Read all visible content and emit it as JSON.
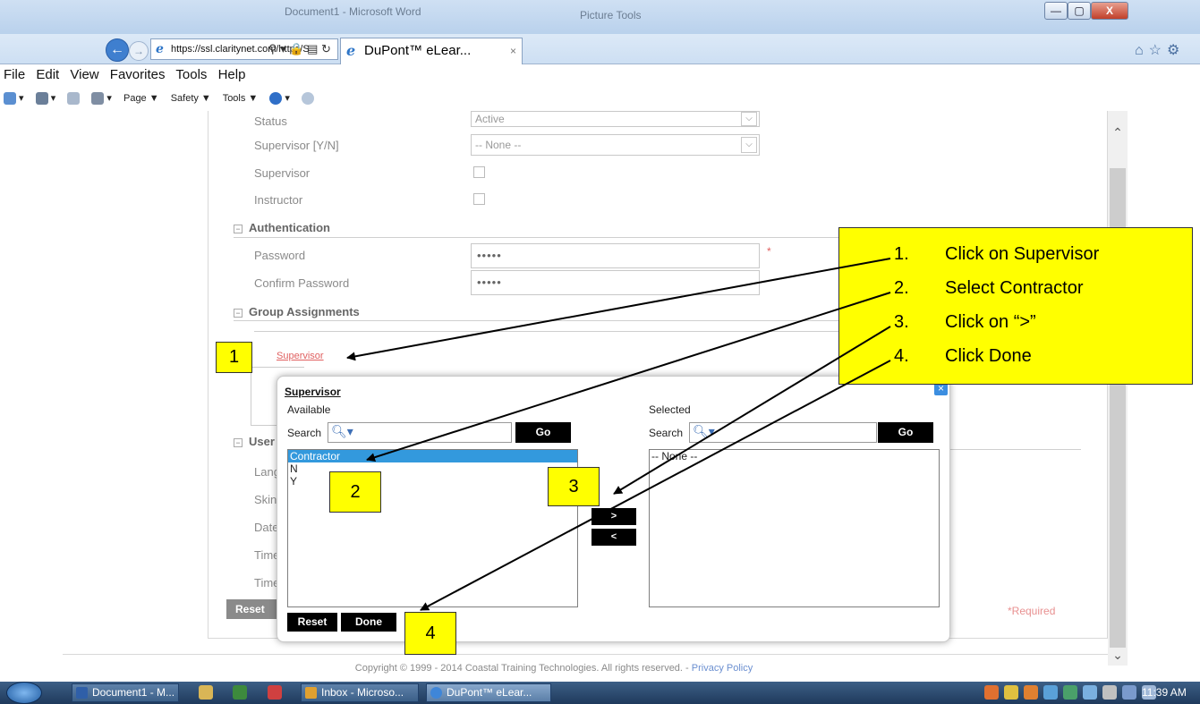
{
  "window": {
    "title": "Document1 - Microsoft Word",
    "context_tab": "Picture Tools",
    "minimize": "—",
    "maximize": "▢",
    "close": "X"
  },
  "browser": {
    "url": "https://ssl.claritynet.com/https/S",
    "tab_title": "DuPont™ eLear...",
    "tab_close": "×",
    "menu": [
      "File",
      "Edit",
      "View",
      "Favorites",
      "Tools",
      "Help"
    ],
    "commands": [
      "Page ▼",
      "Safety ▼",
      "Tools ▼"
    ]
  },
  "form": {
    "status_label": "Status",
    "status_value": "Active",
    "supervisor_yn_label": "Supervisor [Y/N]",
    "supervisor_yn_value": "-- None --",
    "supervisor_label": "Supervisor",
    "instructor_label": "Instructor",
    "auth_section": "Authentication",
    "password_label": "Password",
    "password_value": "•••••",
    "confirm_label": "Confirm Password",
    "confirm_value": "•••••",
    "required_star": "*",
    "group_section": "Group Assignments",
    "supervisor_link": "Supervisor",
    "user_section_partial": "User",
    "partial_labels": [
      "Lang",
      "Skin",
      "Date",
      "Time",
      "Time"
    ],
    "reset_partial": "Reset",
    "required_note": "*Required"
  },
  "popup": {
    "title": "Supervisor",
    "available_label": "Available",
    "selected_label": "Selected",
    "search_label": "Search",
    "go_label": "Go",
    "available_items": [
      "Contractor",
      "N",
      "Y"
    ],
    "selected_items": [
      "-- None --"
    ],
    "move_right": ">",
    "move_left": "<",
    "reset_label": "Reset",
    "done_label": "Done",
    "close_icon": "×"
  },
  "callouts": {
    "c1": "1",
    "c2": "2",
    "c3": "3",
    "c4": "4",
    "steps": [
      {
        "n": "1.",
        "text": "Click on Supervisor"
      },
      {
        "n": "2.",
        "text": "Select Contractor"
      },
      {
        "n": "3.",
        "text": "Click on “>”"
      },
      {
        "n": "4.",
        "text": "Click Done"
      }
    ]
  },
  "footer": {
    "copyright": "Copyright © 1999 - 2014 Coastal Training Technologies. All rights reserved. - ",
    "privacy": "Privacy Policy"
  },
  "taskbar": {
    "items": [
      "Document1 - M...",
      "Inbox - Microso...",
      "DuPont™ eLear..."
    ],
    "clock": "11:39 AM"
  },
  "colors": {
    "callout_yellow": "#ffff00",
    "selection_blue": "#3399dd",
    "link_red": "#e06060"
  }
}
